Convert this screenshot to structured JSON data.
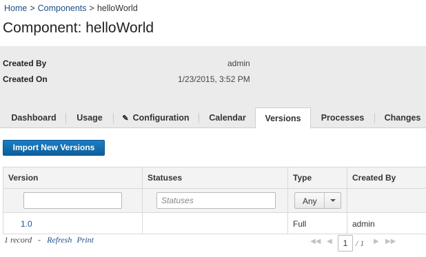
{
  "breadcrumb": {
    "home": "Home",
    "sep1": ">",
    "components": "Components",
    "sep2": ">",
    "current": "helloWorld"
  },
  "page_title": "Component: helloWorld",
  "info": {
    "created_by_label": "Created By",
    "created_by_value": "admin",
    "created_on_label": "Created On",
    "created_on_value": "1/23/2015, 3:52 PM"
  },
  "tabs": [
    {
      "label": "Dashboard",
      "active": false
    },
    {
      "label": "Usage",
      "active": false
    },
    {
      "label": "Configuration",
      "active": false,
      "icon": "pencil-icon"
    },
    {
      "label": "Calendar",
      "active": false
    },
    {
      "label": "Versions",
      "active": true
    },
    {
      "label": "Processes",
      "active": false
    },
    {
      "label": "Changes",
      "active": false
    }
  ],
  "import_button": "Import New Versions",
  "table": {
    "headers": [
      "Version",
      "Statuses",
      "Type",
      "Created By"
    ],
    "filters": {
      "version_value": "",
      "statuses_placeholder": "Statuses",
      "type_selected": "Any"
    },
    "rows": [
      {
        "version": "1.0",
        "statuses": "",
        "type": "Full",
        "created_by": "admin"
      }
    ]
  },
  "footer": {
    "record_count": "1 record",
    "dash": "-",
    "refresh": "Refresh",
    "print": "Print"
  },
  "pager": {
    "current_page": "1",
    "total": "/ 1"
  },
  "colors": {
    "accent": "#1a7fc4",
    "link": "#1a4f86",
    "panel_bg": "#ebebeb"
  }
}
